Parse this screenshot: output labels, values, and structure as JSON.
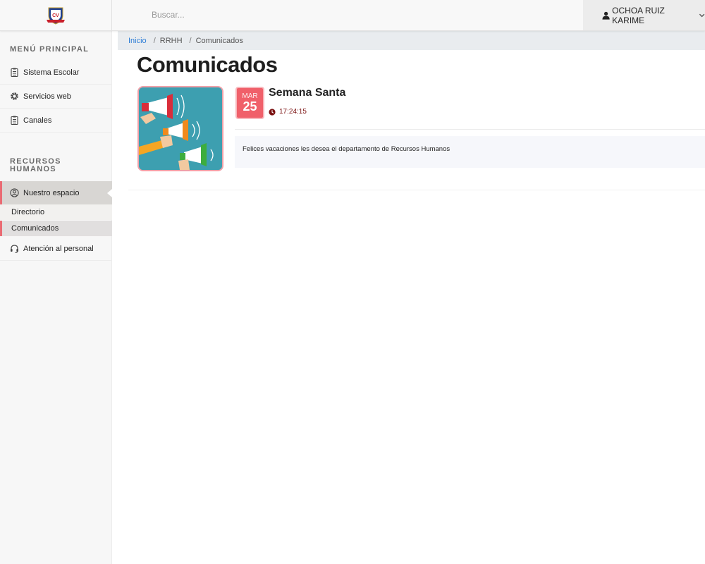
{
  "header": {
    "logo_alt": "logo",
    "search_placeholder": "Buscar...",
    "user_name": "OCHOA RUIZ KARIME"
  },
  "sidebar": {
    "section_main": "MENÚ PRINCIPAL",
    "main_items": [
      {
        "label": "Sistema Escolar",
        "icon": "clipboard-icon"
      },
      {
        "label": "Servicios web",
        "icon": "gear-icon"
      },
      {
        "label": "Canales",
        "icon": "clipboard-icon"
      }
    ],
    "section_hr": "RECURSOS HUMANOS",
    "hr_items": [
      {
        "label": "Nuestro espacio",
        "icon": "user-circle-icon",
        "active": true
      },
      {
        "label": "Directorio"
      },
      {
        "label": "Comunicados",
        "active": true
      },
      {
        "label": "Atención al personal",
        "icon": "headset-icon"
      }
    ]
  },
  "breadcrumb": [
    "Inicio",
    "RRHH",
    "Comunicados"
  ],
  "page_title": "Comunicados",
  "announcements": [
    {
      "month": "MAR",
      "day": "25",
      "title": "Semana Santa",
      "time": "17:24:15",
      "body": "Felices vacaciones les desea el departamento de Recursos Humanos"
    }
  ],
  "colors": {
    "accent": "#ea6b73",
    "badge": "#f0606a",
    "link": "#2e7ed6",
    "time": "#7a1010"
  }
}
